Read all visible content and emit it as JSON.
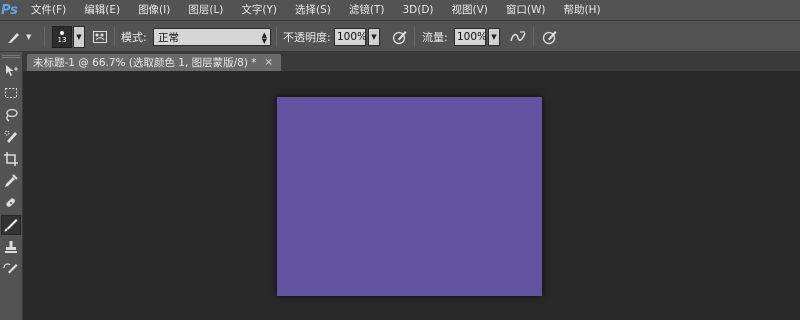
{
  "menu": {
    "logo": "Ps",
    "items": [
      "文件(F)",
      "编辑(E)",
      "图像(I)",
      "图层(L)",
      "文字(Y)",
      "选择(S)",
      "滤镜(T)",
      "3D(D)",
      "视图(V)",
      "窗口(W)",
      "帮助(H)"
    ]
  },
  "options": {
    "brush_size": "13",
    "mode_label": "模式:",
    "mode_value": "正常",
    "opacity_label": "不透明度:",
    "opacity_value": "100%",
    "flow_label": "流量:",
    "flow_value": "100%"
  },
  "document": {
    "tab_title": "未标题-1 @ 66.7% (选取颜色 1, 图层蒙版/8) *",
    "close_glyph": "×",
    "canvas_color": "#6253a0"
  },
  "colors": {
    "chrome": "#535353",
    "workspace": "#282828",
    "accent": "#5aa9e6"
  },
  "toolbar": {
    "tools": [
      "move-tool",
      "marquee-tool",
      "lasso-tool",
      "quick-selection-tool",
      "crop-tool",
      "eyedropper-tool",
      "healing-brush-tool",
      "brush-tool",
      "clone-stamp-tool",
      "history-brush-tool"
    ],
    "active": "brush-tool"
  }
}
